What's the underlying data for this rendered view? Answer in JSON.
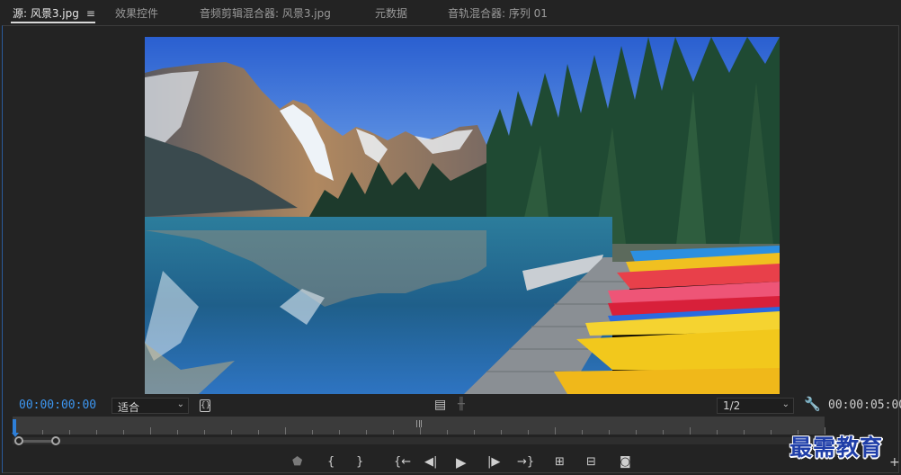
{
  "tabs": [
    {
      "label": "源: 风景3.jpg",
      "active": true
    },
    {
      "label": "效果控件",
      "active": false
    },
    {
      "label": "音频剪辑混合器: 风景3.jpg",
      "active": false
    },
    {
      "label": "元数据",
      "active": false
    },
    {
      "label": "音轨混合器: 序列 01",
      "active": false
    }
  ],
  "tab_menu_icon": "≡",
  "controls": {
    "timecode_current": "00:00:00:00",
    "timecode_duration": "00:00:05:00",
    "fit_select": "适合",
    "resolution_select": "1/2",
    "safe_margin_icon": "{ }"
  },
  "colors": {
    "accent_blue": "#2e7fd8",
    "timecode_blue": "#3d96f0",
    "panel_bg": "#232323",
    "watermark_blue": "#1f3ea8"
  },
  "transport": [
    {
      "name": "marker-icon",
      "glyph": "⬟"
    },
    {
      "name": "mark-in-icon",
      "glyph": "{"
    },
    {
      "name": "mark-out-icon",
      "glyph": "}"
    },
    {
      "name": "go-to-in-icon",
      "glyph": "{←"
    },
    {
      "name": "step-back-icon",
      "glyph": "◀|"
    },
    {
      "name": "play-icon",
      "glyph": "▶"
    },
    {
      "name": "step-forward-icon",
      "glyph": "|▶"
    },
    {
      "name": "go-to-out-icon",
      "glyph": "→}"
    },
    {
      "name": "insert-icon",
      "glyph": "⊞"
    },
    {
      "name": "overwrite-icon",
      "glyph": "⊟"
    },
    {
      "name": "export-frame-icon",
      "glyph": "📷"
    }
  ],
  "watermark": "最需教育"
}
